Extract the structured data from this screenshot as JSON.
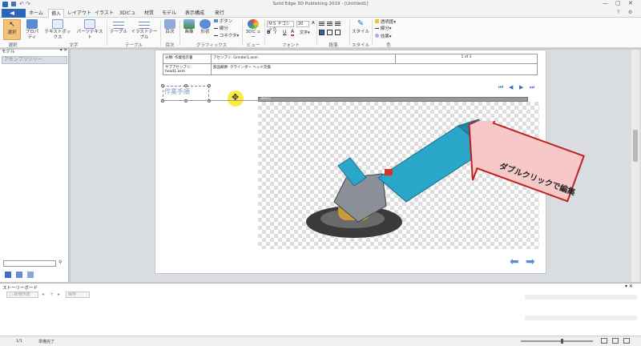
{
  "app": {
    "title": "Solid Edge 3D Publishing 2019 - [Untitled1]"
  },
  "tabs": [
    "ホーム",
    "挿入",
    "レイアウト",
    "イラスト",
    "3Dビュー",
    "材質",
    "モデル",
    "表示構成",
    "発行"
  ],
  "ribbon": {
    "tools": {
      "select": "選択",
      "select_btn": "選択",
      "properties": "プロパティ",
      "textbox": "テキストボックス",
      "parts_text": "パーツテキスト"
    },
    "text_group": "文字",
    "table_group": "テーブル",
    "table_btn": "テーブル",
    "illust_table": "イラストテーブル",
    "cover": "目次",
    "cover_group": "目次",
    "image_btn": "画像",
    "shape_btn": "形状",
    "button_btn": "ボタン",
    "line_btn": "線分",
    "connector_btn": "コネクタ",
    "graphics_group": "グラフィックス",
    "view3d": "3Dビュー",
    "view_group": "ビュー",
    "font_name": "ＭＳ Ｐゴシック",
    "font_size": "20",
    "font_group": "フォント",
    "char_label": "文字",
    "para_group": "段落",
    "style_btn": "スタイル",
    "style_group": "スタイル",
    "transparency": "透明度",
    "line2": "線分",
    "effect": "効果",
    "color_group": "色"
  },
  "leftpanel": {
    "assembly": "アセンブリツリー",
    "model": "モデル"
  },
  "page": {
    "header_row1_a": "分類: 作業指示書",
    "header_row1_b": "アセンブリ: Grinder1.asm",
    "header_row1_c": "1 of 1",
    "header_row2_a": "サブアセンブリ: head1.asm",
    "header_row2_b": "部品概要: グラインダー ヘッド交換",
    "textbox": "作業手順",
    "viewer_label": "3D(1)",
    "callout": "ダブルクリックで編集"
  },
  "storyboard": {
    "title": "ストーリーボード",
    "new": "新規作成",
    "save": "保存"
  },
  "status": {
    "page": "1/1",
    "ready": "準備完了"
  }
}
